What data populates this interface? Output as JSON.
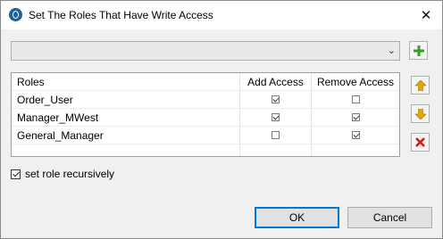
{
  "window": {
    "title": "Set The Roles That Have Write Access"
  },
  "combo": {
    "value": ""
  },
  "table": {
    "headers": [
      "Roles",
      "Add Access",
      "Remove Access"
    ],
    "rows": [
      {
        "role": "Order_User",
        "add": true,
        "remove": false
      },
      {
        "role": "Manager_MWest",
        "add": true,
        "remove": true
      },
      {
        "role": "General_Manager",
        "add": false,
        "remove": true
      }
    ]
  },
  "recursive": {
    "label": "set role recursively",
    "checked": true
  },
  "buttons": {
    "ok": "OK",
    "cancel": "Cancel"
  },
  "icons": {
    "add": "plus-icon",
    "up": "arrow-up-icon",
    "down": "arrow-down-icon",
    "remove": "delete-x-icon"
  },
  "colors": {
    "add": "#3a9a2a",
    "arrows": "#d39b00",
    "remove": "#d11a1a"
  }
}
